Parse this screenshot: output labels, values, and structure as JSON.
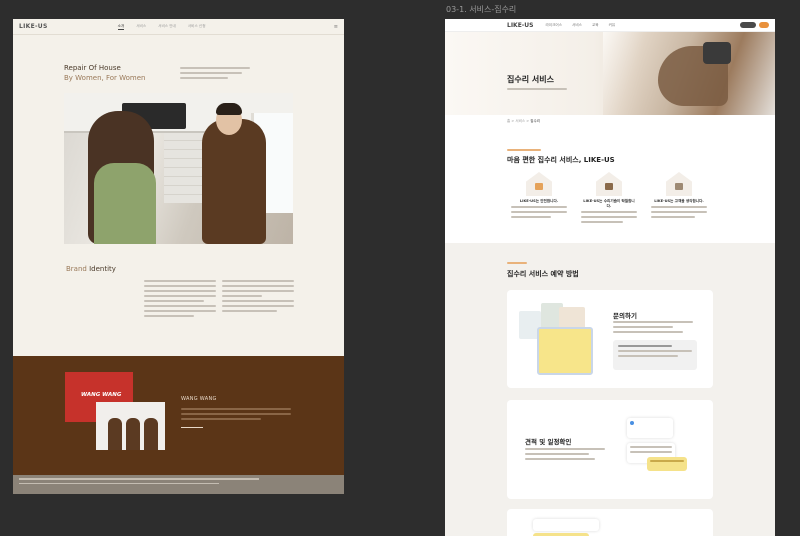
{
  "left_artboard": {
    "logo": "LIKE-US",
    "nav": [
      "소개",
      "서비스",
      "서비스 안내",
      "서비스 신청"
    ],
    "hero_line1": "Repair Of House",
    "hero_line2": "By Women, For Women",
    "brand_word1": "Brand",
    "brand_word2": "Identity",
    "red_card_text": "WANG WANG",
    "wang_title": "WANG WANG"
  },
  "right_artboard": {
    "artboard_title": "03-1. 서비스-집수리",
    "logo": "LIKE-US",
    "nav": [
      "라이크어스",
      "서비스",
      "교육",
      "커뮤"
    ],
    "hero_title": "집수리 서비스",
    "breadcrumb": [
      "홈",
      "서비스",
      "집수리"
    ],
    "section1_title": "마음 편한 집수리 서비스, LIKE-US",
    "features": [
      {
        "title": "LIKE-US는 안전합니다."
      },
      {
        "title": "LIKE-US는 수리기술이 탁월합니다."
      },
      {
        "title": "LIKE-US는 고객을 생각합니다."
      }
    ],
    "section2_title": "집수리 서비스 예약 방법",
    "card1_title": "문의하기",
    "card2_title": "견적 및 일정확인"
  },
  "colors": {
    "brown": "#5b3517",
    "accent_orange": "#e9913c",
    "red": "#c6322b"
  }
}
